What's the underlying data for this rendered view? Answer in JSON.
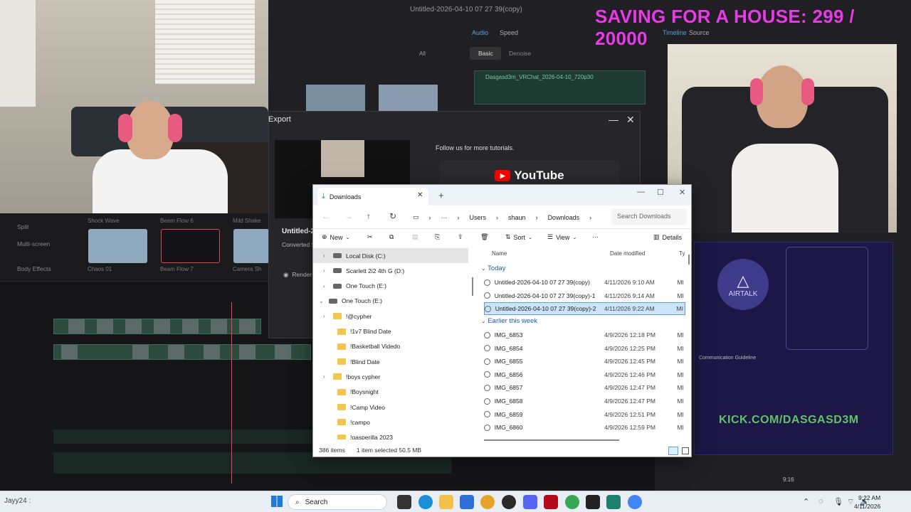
{
  "overlay": {
    "saving_text": "SAVING FOR A HOUSE: 299 / 20000"
  },
  "editor": {
    "title": "Untitled-2026-04-10 07 27 39(copy)",
    "tabs": [
      "Audio",
      "Speed"
    ],
    "subtabs": [
      "Basic",
      "Denoise"
    ],
    "clip_name": "Dasgasd3m_VRChat_2026-04-10_720p30",
    "all_label": "All",
    "right_tabs": [
      "Timeline",
      "Source"
    ]
  },
  "left_panel": {
    "items": [
      "Split",
      "Multi-screen",
      "Body Effects"
    ],
    "thumbs": [
      "Shock Wave",
      "Beam Flow 6",
      "Mild Shake",
      "Chaos 01",
      "Beam Flow 7",
      "Camera Sh"
    ]
  },
  "export": {
    "title": "Export",
    "file_partial": "Untitled-2",
    "converted": "Converted S",
    "render": "Render",
    "follow_text": "Follow us for more tutorials.",
    "youtube_label": "YouTube"
  },
  "explorer": {
    "tab_label": "Downloads",
    "breadcrumb": [
      "Users",
      "shaun",
      "Downloads"
    ],
    "search_placeholder": "Search Downloads",
    "toolbar": {
      "new": "New",
      "sort": "Sort",
      "view": "View",
      "details": "Details"
    },
    "tree": [
      {
        "label": "Local Disk (C:)",
        "kind": "drive",
        "selected": true
      },
      {
        "label": "Scarlett 2i2 4th G (D:)",
        "kind": "drive"
      },
      {
        "label": "One Touch (E:)",
        "kind": "drive"
      },
      {
        "label": "One Touch (E:)",
        "kind": "drive",
        "expanded": true
      },
      {
        "label": "!@cypher",
        "kind": "folder"
      },
      {
        "label": "!1v7 Blind Date",
        "kind": "folder"
      },
      {
        "label": "!Basketball Videdo",
        "kind": "folder"
      },
      {
        "label": "!Blind Date",
        "kind": "folder"
      },
      {
        "label": "!boys cypher",
        "kind": "folder"
      },
      {
        "label": "!Boysnight",
        "kind": "folder"
      },
      {
        "label": "!Camp Video",
        "kind": "folder"
      },
      {
        "label": "!campo",
        "kind": "folder"
      },
      {
        "label": "!gasperilla 2023",
        "kind": "folder"
      }
    ],
    "columns": {
      "name": "Name",
      "date": "Date modified",
      "type": "Ty"
    },
    "groups": {
      "today": "Today",
      "earlier": "Earlier this week"
    },
    "today_files": [
      {
        "name": "Untitled-2026-04-10 07 27 39(copy)",
        "date": "4/11/2026 9:10 AM",
        "type": "MI"
      },
      {
        "name": "Untitled-2026-04-10 07 27 39(copy)-1",
        "date": "4/11/2026 9:14 AM",
        "type": "MI"
      },
      {
        "name": "Untitled-2026-04-10 07 27 39(copy)-2",
        "date": "4/11/2026 9:22 AM",
        "type": "MI",
        "selected": true
      }
    ],
    "earlier_files": [
      {
        "name": "IMG_6853",
        "date": "4/9/2026 12:18 PM",
        "type": "MI"
      },
      {
        "name": "IMG_6854",
        "date": "4/9/2026 12:25 PM",
        "type": "MI"
      },
      {
        "name": "IMG_6855",
        "date": "4/9/2026 12:45 PM",
        "type": "MI"
      },
      {
        "name": "IMG_6856",
        "date": "4/9/2026 12:46 PM",
        "type": "MI"
      },
      {
        "name": "IMG_6857",
        "date": "4/9/2026 12:47 PM",
        "type": "MI"
      },
      {
        "name": "IMG_6858",
        "date": "4/9/2026 12:47 PM",
        "type": "MI"
      },
      {
        "name": "IMG_6859",
        "date": "4/9/2026 12:51 PM",
        "type": "MI"
      },
      {
        "name": "IMG_6860",
        "date": "4/9/2026 12:59 PM",
        "type": "MI"
      }
    ],
    "status": {
      "count": "386 items",
      "selection": "1 item selected  50.5 MB"
    }
  },
  "airtalk": {
    "logo_text": "AIRTALK",
    "kick_text": "KICK.COM/DASGASD3M",
    "guideline_title": "Communication Guideline"
  },
  "taskbar": {
    "user": "Jayy24 :",
    "search_label": "Search",
    "time": "9:22 AM",
    "date": "4/11/2026",
    "counter": "9:16"
  },
  "colors": {
    "overlay_text": "#e040e0",
    "accent": "#5aa0dc",
    "folder": "#f3c64e"
  }
}
